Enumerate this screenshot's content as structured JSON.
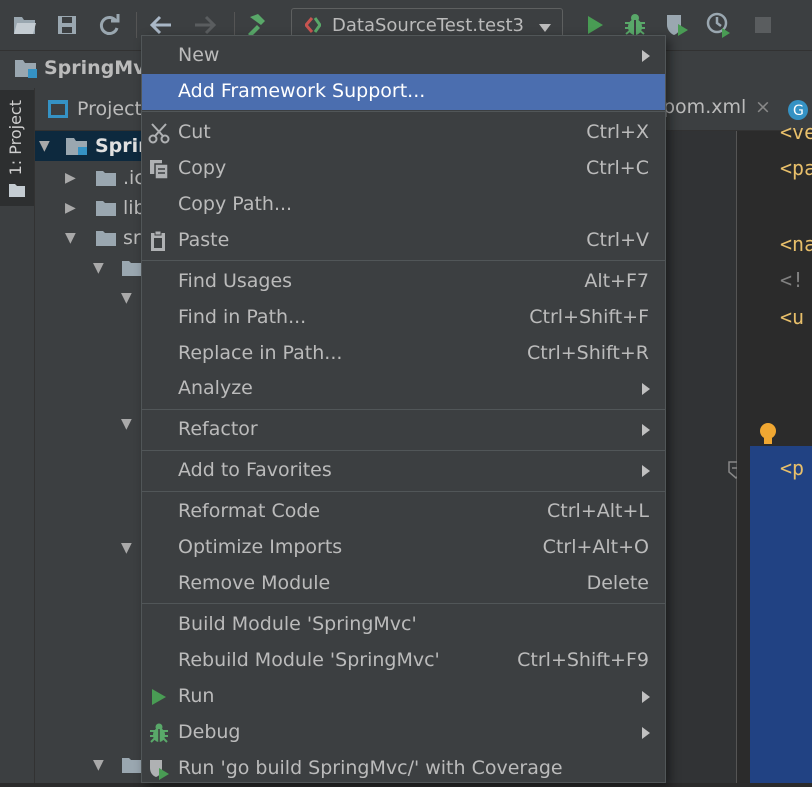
{
  "run_config": {
    "label": "DataSourceTest.test3"
  },
  "navbar": {
    "project": "SpringMvc"
  },
  "tool_strip": {
    "project_tab": "1: Project"
  },
  "project_panel": {
    "header": "Project",
    "tree": [
      "Sprin",
      ".ic",
      "lib",
      "sr"
    ]
  },
  "editor": {
    "tab_label": "pom.xml",
    "tab_close": "×",
    "code": [
      "<ve",
      "<pa",
      "<na",
      "<!",
      "<u",
      "<p"
    ]
  },
  "context_menu": {
    "items": [
      {
        "label": "New",
        "shortcut": "",
        "submenu": true,
        "icon": ""
      },
      {
        "label": "Add Framework Support...",
        "shortcut": "",
        "submenu": false,
        "icon": "",
        "highlighted": true
      },
      {
        "label": "Cut",
        "shortcut": "Ctrl+X",
        "submenu": false,
        "icon": "scissors-icon"
      },
      {
        "label": "Copy",
        "shortcut": "Ctrl+C",
        "submenu": false,
        "icon": "copy-icon"
      },
      {
        "label": "Copy Path...",
        "shortcut": "",
        "submenu": false,
        "icon": ""
      },
      {
        "label": "Paste",
        "shortcut": "Ctrl+V",
        "submenu": false,
        "icon": "paste-icon"
      },
      {
        "label": "Find Usages",
        "shortcut": "Alt+F7",
        "submenu": false,
        "icon": ""
      },
      {
        "label": "Find in Path...",
        "shortcut": "Ctrl+Shift+F",
        "submenu": false,
        "icon": ""
      },
      {
        "label": "Replace in Path...",
        "shortcut": "Ctrl+Shift+R",
        "submenu": false,
        "icon": ""
      },
      {
        "label": "Analyze",
        "shortcut": "",
        "submenu": true,
        "icon": ""
      },
      {
        "label": "Refactor",
        "shortcut": "",
        "submenu": true,
        "icon": ""
      },
      {
        "label": "Add to Favorites",
        "shortcut": "",
        "submenu": true,
        "icon": ""
      },
      {
        "label": "Reformat Code",
        "shortcut": "Ctrl+Alt+L",
        "submenu": false,
        "icon": ""
      },
      {
        "label": "Optimize Imports",
        "shortcut": "Ctrl+Alt+O",
        "submenu": false,
        "icon": ""
      },
      {
        "label": "Remove Module",
        "shortcut": "Delete",
        "submenu": false,
        "icon": ""
      },
      {
        "label": "Build Module 'SpringMvc'",
        "shortcut": "",
        "submenu": false,
        "icon": ""
      },
      {
        "label": "Rebuild Module 'SpringMvc'",
        "shortcut": "Ctrl+Shift+F9",
        "submenu": false,
        "icon": ""
      },
      {
        "label": "Run",
        "shortcut": "",
        "submenu": true,
        "icon": "run-icon"
      },
      {
        "label": "Debug",
        "shortcut": "",
        "submenu": true,
        "icon": "debug-icon"
      },
      {
        "label": "Run 'go build SpringMvc/' with Coverage",
        "shortcut": "",
        "submenu": false,
        "icon": "coverage-icon"
      }
    ]
  },
  "colors": {
    "menu_highlight": "#4b6eaf",
    "run_green": "#499c54",
    "build_green": "#59a869",
    "editor_selection": "#214283"
  }
}
